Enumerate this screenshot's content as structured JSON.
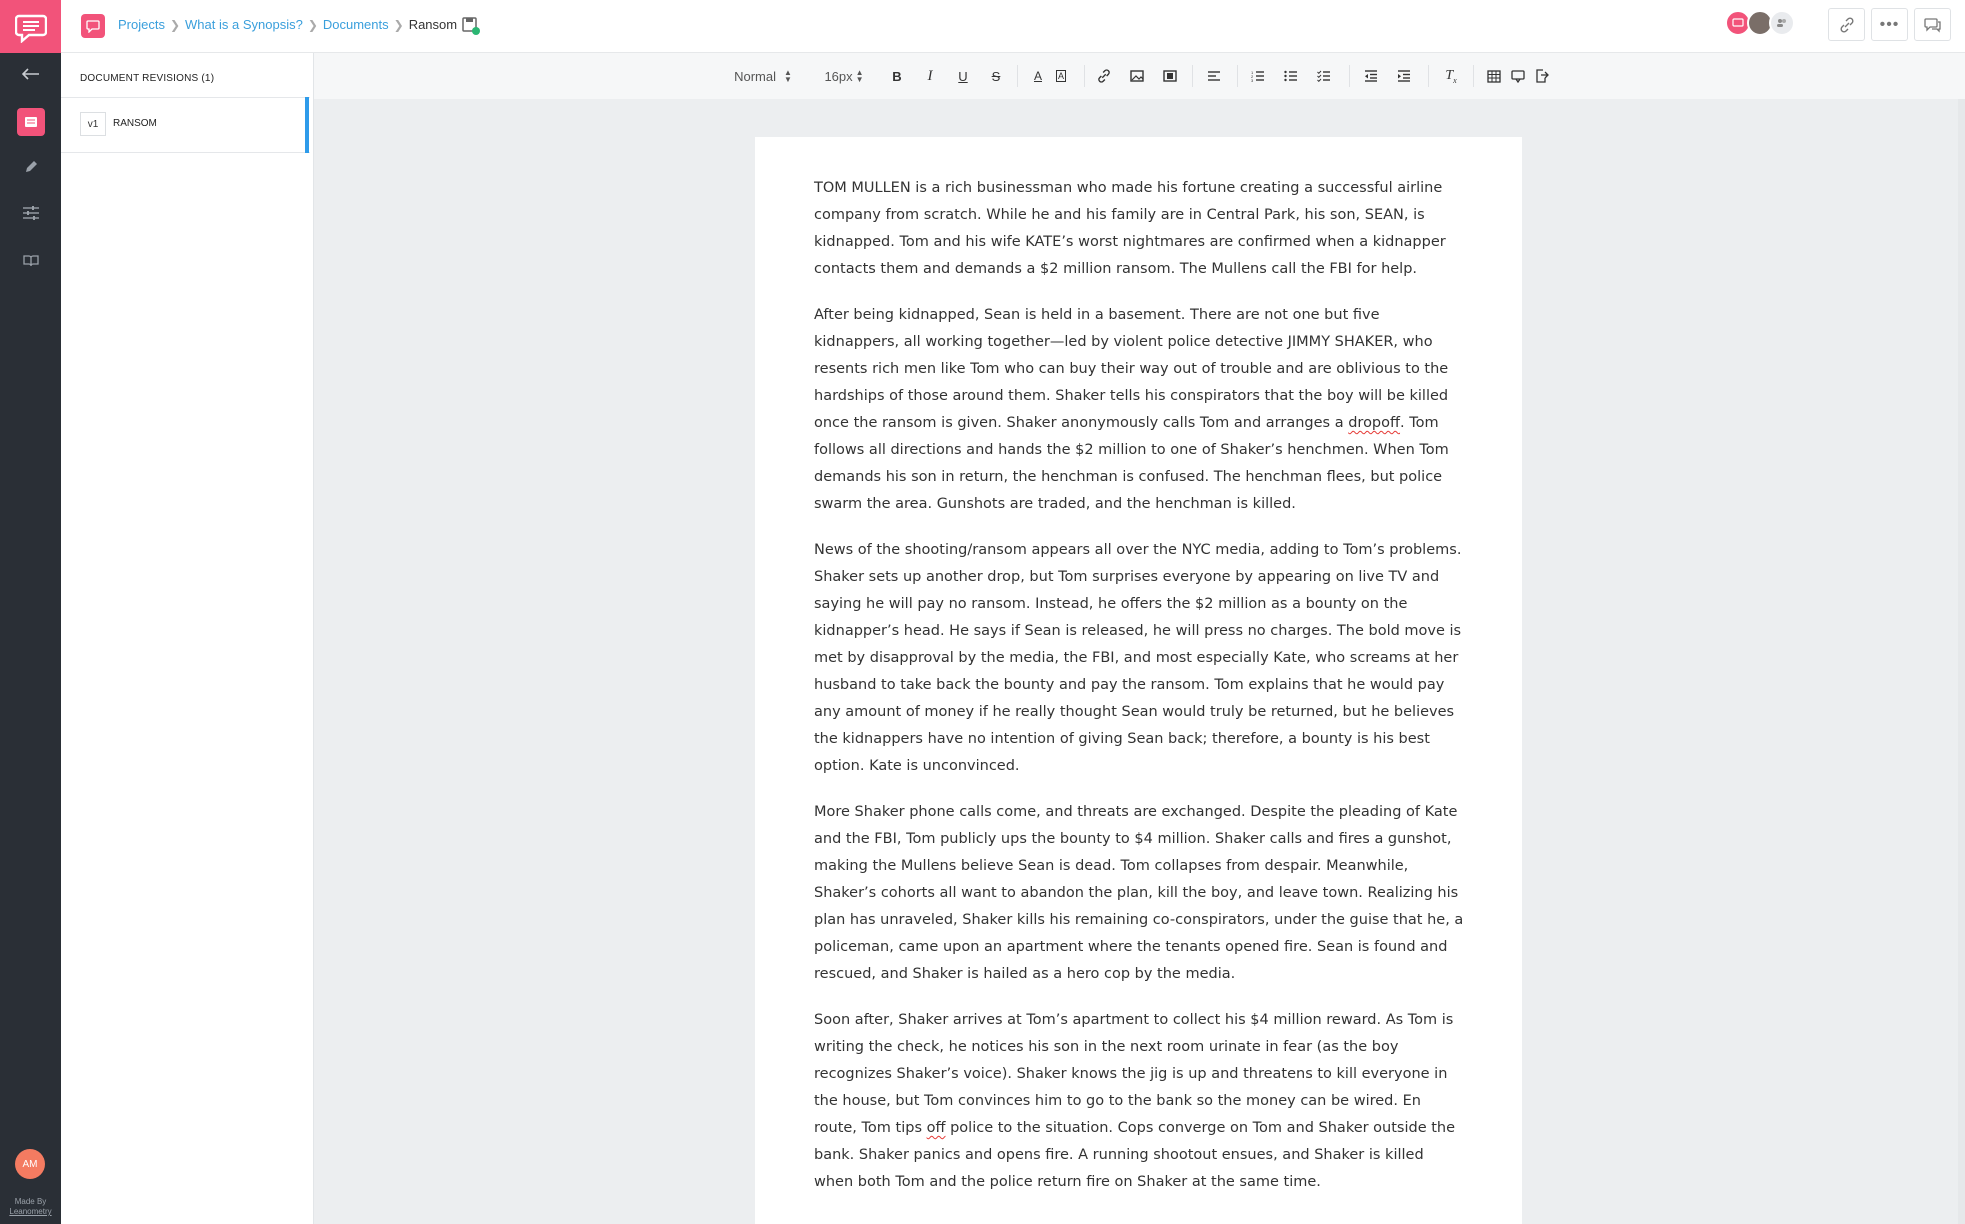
{
  "breadcrumb": {
    "items": [
      "Projects",
      "What is a Synopsis?",
      "Documents"
    ],
    "current": "Ransom"
  },
  "rail": {
    "avatar_initials": "AM",
    "made_by_line1": "Made By",
    "made_by_line2": "Leanometry"
  },
  "revisions": {
    "title": "DOCUMENT REVISIONS (1)",
    "items": [
      {
        "version": "v1",
        "name": "RANSOM"
      }
    ]
  },
  "toolbar": {
    "format": "Normal",
    "font_size": "16px"
  },
  "document": {
    "paragraphs": [
      "TOM MULLEN is a rich businessman who made his fortune creating a successful airline company from scratch. While he and his family are in Central Park, his son, SEAN, is kidnapped. Tom and his wife KATE’s worst nightmares are confirmed when a kidnapper contacts them and demands a $2 million ransom. The Mullens call the FBI for help.",
      "News of the shooting/ransom appears all over the NYC media, adding to Tom’s problems. Shaker sets up another drop, but Tom surprises everyone by appearing on live TV and saying he will pay no ransom. Instead, he offers the $2 million as a bounty on the kidnapper’s head. He says if Sean is released, he will press no charges. The bold move is met by disapproval by the media, the FBI, and most especially Kate, who screams at her husband to take back the bounty and pay the ransom. Tom explains that he would pay any amount of money if he really thought Sean would truly be returned, but he believes the kidnappers have no intention of giving Sean back; therefore, a bounty is his best option. Kate is unconvinced.",
      "More Shaker phone calls come, and threats are exchanged. Despite the pleading of Kate and the FBI, Tom publicly ups the bounty to $4 million. Shaker calls and fires a gunshot, making the Mullens believe Sean is dead. Tom collapses from despair. Meanwhile, Shaker’s cohorts all want to abandon the plan, kill the boy, and leave town. Realizing his plan has unraveled, Shaker kills his remaining co-conspirators, under the guise that he, a policeman, came upon an apartment where the tenants opened fire. Sean is found and rescued, and Shaker is hailed as a hero cop by the media."
    ],
    "p2": {
      "a": "After being kidnapped, Sean is held in a basement. There are not one but five kidnappers, all working together—led by violent police detective JIMMY SHAKER, who resents rich men like Tom who can buy their way out of trouble and are oblivious to the hardships of those around them. Shaker tells his conspirators that the boy will be killed once the ransom is given. Shaker anonymously calls Tom and arranges a ",
      "flag": "dropoff",
      "b": ". Tom follows all directions and hands the $2 million to one of Shaker’s henchmen. When Tom demands his son in return, the henchman is confused. The henchman flees, but police swarm the area. Gunshots are traded, and the henchman is killed."
    },
    "p5": {
      "a": "Soon after, Shaker arrives at Tom’s apartment to collect his $4 million reward. As Tom is writing the check, he notices his son in the next room urinate in fear (as the boy recognizes Shaker’s voice). Shaker knows the jig is up and threatens to kill everyone in the house, but Tom convinces him to go to the bank so the money can be wired. En route, Tom tips ",
      "flag": "off",
      "b": " police to the situation. Cops converge on Tom and Shaker outside the bank. Shaker panics and opens fire. A running shootout ensues, and Shaker is killed when both Tom and the police return fire on Shaker at the same time."
    }
  }
}
